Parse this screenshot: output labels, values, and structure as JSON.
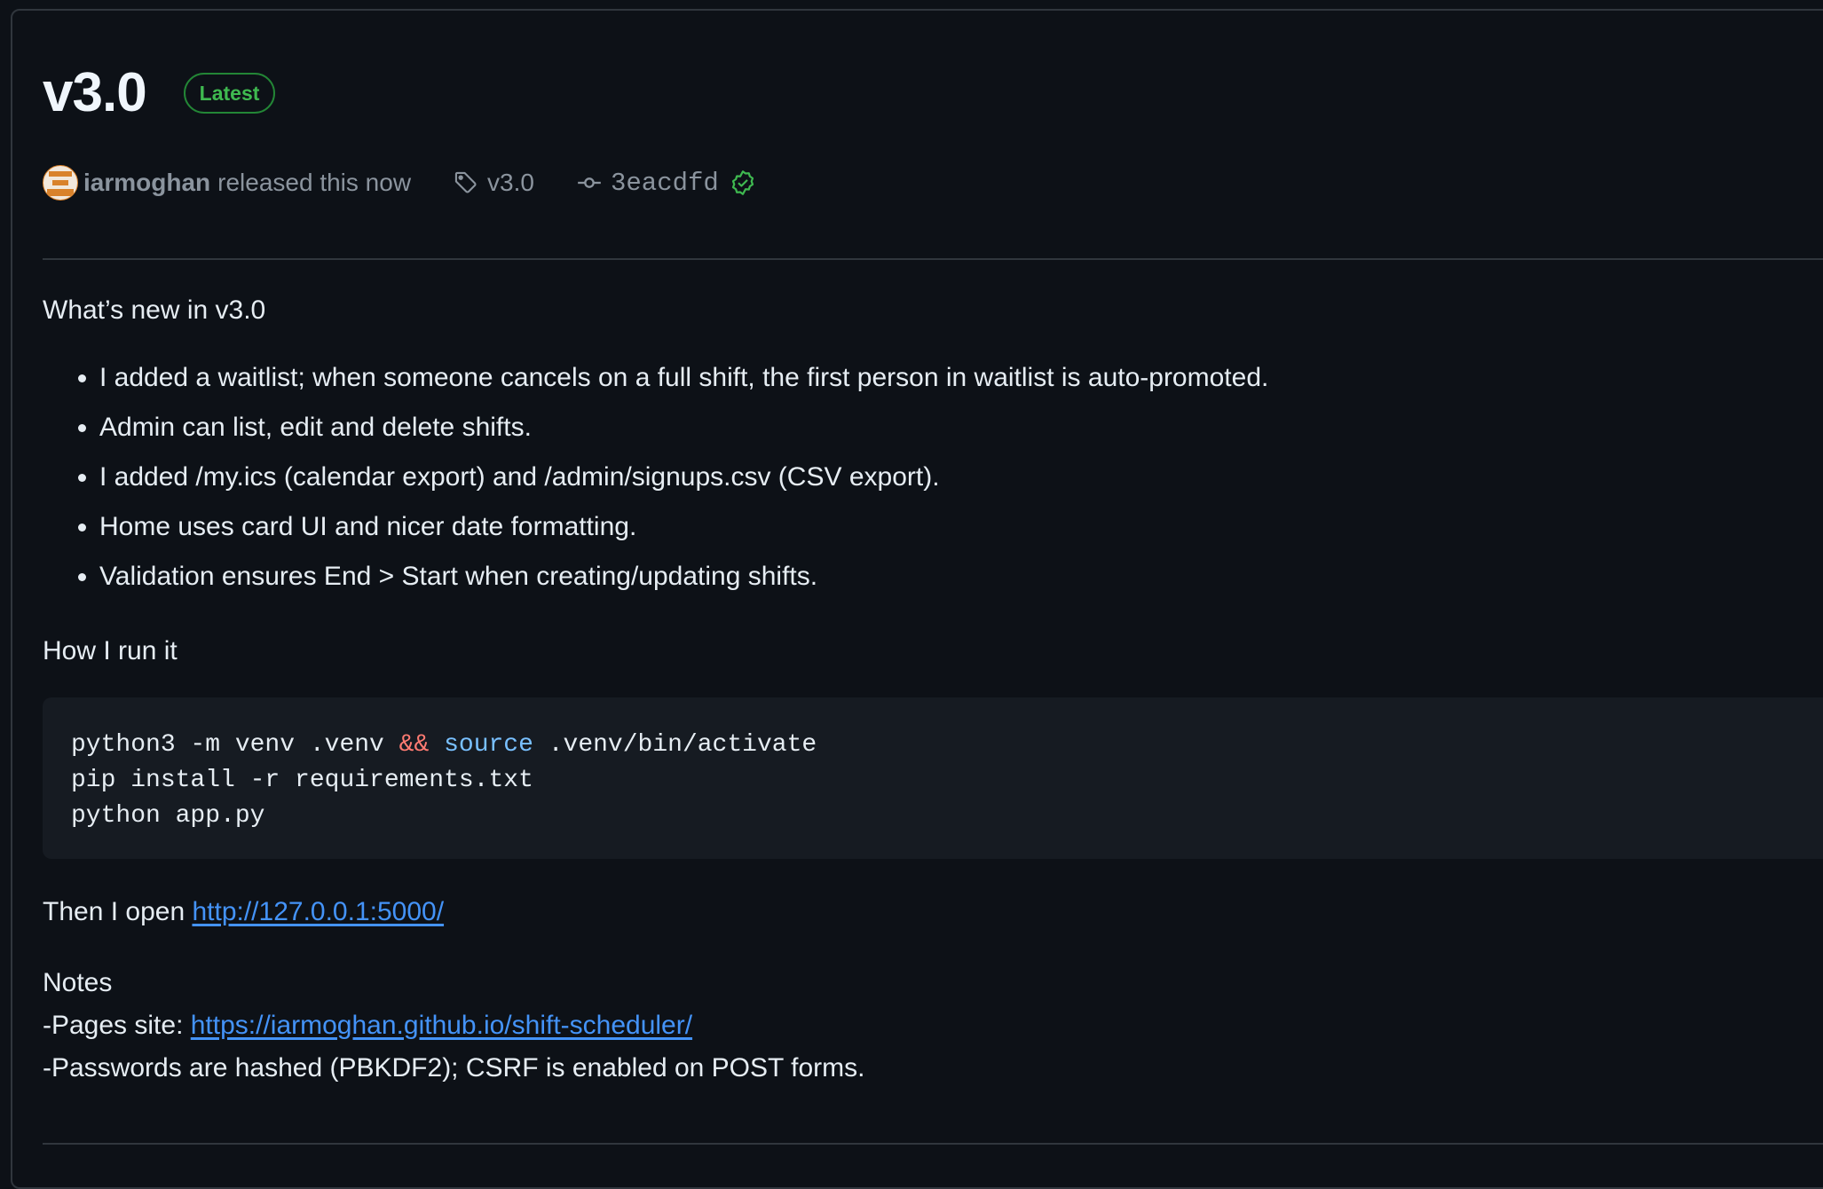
{
  "release": {
    "title": "v3.0",
    "badge": "Latest",
    "author": "iarmoghan",
    "released_text": "released this now",
    "tag": "v3.0",
    "commit": "3eacdfd"
  },
  "notes": {
    "heading": "What’s new in v3.0",
    "changes": [
      "I added a waitlist; when someone cancels on a full shift, the first person in waitlist is auto-promoted.",
      "Admin can list, edit and delete shifts.",
      "I added /my.ics (calendar export) and /admin/signups.csv (CSV export).",
      "Home uses card UI and nicer date formatting.",
      "Validation ensures End > Start when creating/updating shifts."
    ],
    "run_heading": "How I run it",
    "code": {
      "line1_a": "python3 -m venv .venv ",
      "line1_op": "&&",
      "line1_sp": " ",
      "line1_kw": "source",
      "line1_b": " .venv/bin/activate",
      "line2": "pip install -r requirements.txt",
      "line3": "python app.py"
    },
    "open_prefix": "Then I open ",
    "open_link": "http://127.0.0.1:5000/",
    "notes_heading": "Notes",
    "pages_prefix": "-Pages site: ",
    "pages_link": "https://iarmoghan.github.io/shift-scheduler/",
    "security_note": "-Passwords are hashed (PBKDF2); CSRF is enabled on POST forms."
  },
  "colors": {
    "background": "#0d1117",
    "badge_green": "#3fb950",
    "link_blue": "#4493f8",
    "code_bg": "#161b22"
  }
}
